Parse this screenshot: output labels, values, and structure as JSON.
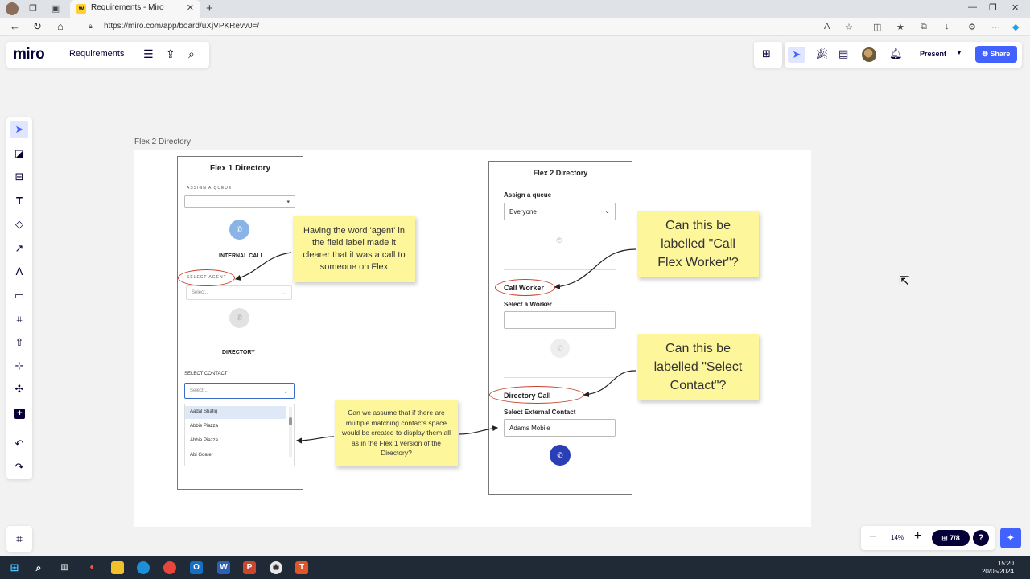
{
  "browser": {
    "tab_title": "Requirements - Miro",
    "tab_favicon": "w",
    "url": "https://miro.com/app/board/uXjVPKRevv0=/"
  },
  "app": {
    "logo": "miro",
    "board_name": "Requirements",
    "present_label": "Present",
    "share_label": "Share",
    "zoom": "14%",
    "pages": "7/8",
    "help": "?"
  },
  "frame": {
    "label": "Flex 2 Directory"
  },
  "flex1": {
    "title": "Flex 1 Directory",
    "assign_queue_label": "ASSIGN A QUEUE",
    "internal_call": "INTERNAL CALL",
    "select_agent_label": "SELECT AGENT",
    "select_placeholder": "Select...",
    "directory": "DIRECTORY",
    "select_contact_label": "SELECT CONTACT",
    "contact_placeholder": "Select...",
    "contacts": [
      "Aadal Shafiq",
      "Abbie Piazza",
      "Abbie Piazza",
      "Abi Goater"
    ]
  },
  "flex2": {
    "title": "Flex 2 Directory",
    "assign_queue_label": "Assign a queue",
    "queue_value": "Everyone",
    "call_worker": "Call Worker",
    "select_worker_label": "Select a Worker",
    "directory_call": "Directory Call",
    "select_external_label": "Select External Contact",
    "external_value": "Adams Mobile"
  },
  "stickies": {
    "agent_note": "Having the word 'agent' in the field label made it clearer that it was a call to someone on Flex",
    "call_flex_worker": "Can this be labelled \"Call Flex Worker\"?",
    "select_contact": "Can this be labelled \"Select Contact\"?",
    "multiple_contacts": "Can we assume that if there are multiple matching contacts space would be created to display them all as in the Flex 1 version of the Directory?"
  },
  "taskbar": {
    "time": "15:20",
    "date": "20/05/2024"
  },
  "colors": {
    "accent": "#4262ff",
    "sticky": "#fdf69b",
    "annotation": "#c8432d",
    "miro_navy": "#050038"
  }
}
